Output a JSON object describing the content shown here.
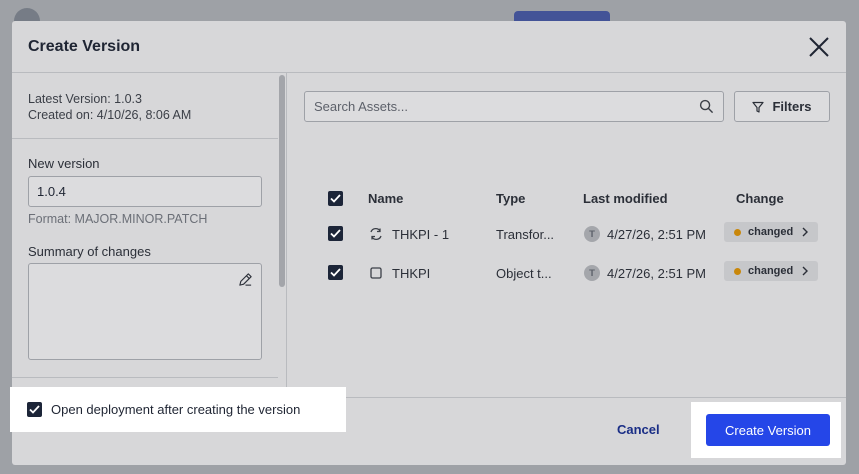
{
  "dialog": {
    "title": "Create Version"
  },
  "left_panel": {
    "latest_version": "Latest Version: 1.0.3",
    "created_on": "Created on: 4/10/26, 8:06 AM",
    "new_version_label": "New version",
    "new_version_value": "1.0.4",
    "format_hint": "Format: MAJOR.MINOR.PATCH",
    "summary_label": "Summary of changes",
    "summary_value": ""
  },
  "assets": {
    "search_placeholder": "Search Assets...",
    "filters_label": "Filters",
    "columns": {
      "name": "Name",
      "type": "Type",
      "last_modified": "Last modified",
      "change": "Change"
    },
    "rows": [
      {
        "name": "THKPI - 1",
        "type": "Transfor...",
        "avatar": "T",
        "last_modified": "4/27/26, 2:51 PM",
        "change": "changed",
        "checked": true,
        "icon": "transform-icon"
      },
      {
        "name": "THKPI",
        "type": "Object t...",
        "avatar": "T",
        "last_modified": "4/27/26, 2:51 PM",
        "change": "changed",
        "checked": true,
        "icon": "object-type-icon"
      }
    ]
  },
  "footer": {
    "open_deployment_label": "Open deployment after creating the version",
    "open_deployment_checked": true,
    "cancel_label": "Cancel",
    "create_label": "Create Version"
  },
  "colors": {
    "primary": "#2546e8",
    "checkbox": "#1c2538",
    "changed_dot": "#c9870a",
    "link": "#1a2e86"
  }
}
